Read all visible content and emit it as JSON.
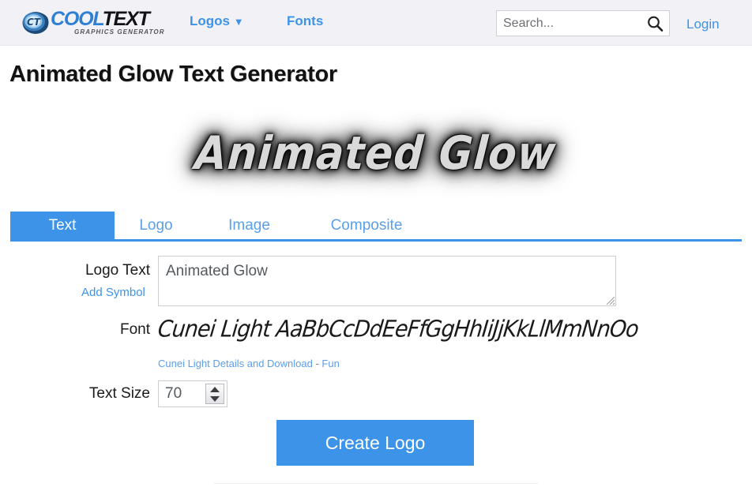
{
  "header": {
    "logo": {
      "icon": "cooltext-swoosh-icon",
      "word_cool": "COOL",
      "word_text": "TEXT",
      "tagline": "GRAPHICS GENERATOR"
    },
    "nav": [
      {
        "label": "Logos",
        "caret": "▼",
        "name": "nav-logos"
      },
      {
        "label": "Fonts",
        "caret": "",
        "name": "nav-fonts"
      }
    ],
    "search": {
      "placeholder": "Search...",
      "value": "",
      "icon": "search-icon"
    },
    "login_label": "Login"
  },
  "page": {
    "title": "Animated Glow Text Generator"
  },
  "preview": {
    "text": "Animated Glow",
    "effect": "animated-glow",
    "font": "Cunei Light"
  },
  "tabs": [
    {
      "label": "Text",
      "active": true
    },
    {
      "label": "Logo",
      "active": false
    },
    {
      "label": "Image",
      "active": false
    },
    {
      "label": "Composite",
      "active": false
    }
  ],
  "form": {
    "logo_text": {
      "label": "Logo Text",
      "add_symbol_label": "Add Symbol",
      "value": "Animated Glow",
      "placeholder": ""
    },
    "font": {
      "label": "Font",
      "preview_text": "Cunei Light AaBbCcDdEeFfGgHhIiJjKkLlMmNnOo",
      "details_link": "Cunei Light Details and Download",
      "separator": " - ",
      "category_link": "Fun"
    },
    "text_size": {
      "label": "Text Size",
      "value": "70",
      "spinner_up": "▲",
      "spinner_down": "▼"
    },
    "submit_label": "Create Logo"
  },
  "colors": {
    "accent_blue": "#3d93e8",
    "link_blue": "#5a9fe8",
    "logo_blue": "#2f7fd4",
    "header_bg": "#f2f2f6",
    "border": "#cdcdd3"
  }
}
